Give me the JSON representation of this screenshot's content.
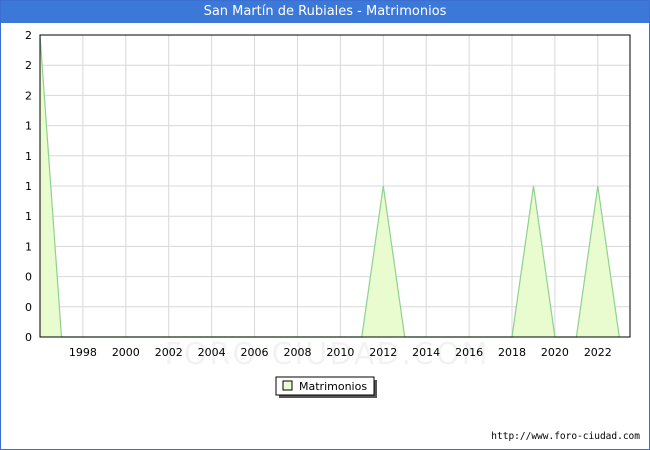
{
  "title": "San Martín de Rubiales - Matrimonios",
  "footer_url": "http://www.foro-ciudad.com",
  "watermark": "FORO-CIUDAD.COM",
  "chart_data": {
    "type": "area",
    "title": "San Martín de Rubiales - Matrimonios",
    "xlabel": "",
    "ylabel": "",
    "xlim": [
      1996,
      2023.5
    ],
    "ylim": [
      0,
      2
    ],
    "x_ticks": [
      1998,
      2000,
      2002,
      2004,
      2006,
      2008,
      2010,
      2012,
      2014,
      2016,
      2018,
      2020,
      2022
    ],
    "y_tick_values": [
      0,
      0.2,
      0.4,
      0.6,
      0.8,
      1.0,
      1.2,
      1.4,
      1.6,
      1.8,
      2.0
    ],
    "y_tick_labels": [
      "0",
      "0",
      "0",
      "1",
      "1",
      "1",
      "1",
      "1",
      "2",
      "2",
      "2"
    ],
    "grid": true,
    "legend_position": "bottom-center",
    "series": [
      {
        "name": "Matrimonios",
        "color": "#8fd18f",
        "fill": "#e8fcd0",
        "x": [
          1996,
          1997,
          1998,
          1999,
          2000,
          2001,
          2002,
          2003,
          2004,
          2005,
          2006,
          2007,
          2008,
          2009,
          2010,
          2011,
          2012,
          2013,
          2014,
          2015,
          2016,
          2017,
          2018,
          2019,
          2020,
          2021,
          2022,
          2023
        ],
        "y": [
          2,
          0,
          0,
          0,
          0,
          0,
          0,
          0,
          0,
          0,
          0,
          0,
          0,
          0,
          0,
          0,
          1,
          0,
          0,
          0,
          0,
          0,
          0,
          1,
          0,
          0,
          1,
          0
        ]
      }
    ]
  }
}
